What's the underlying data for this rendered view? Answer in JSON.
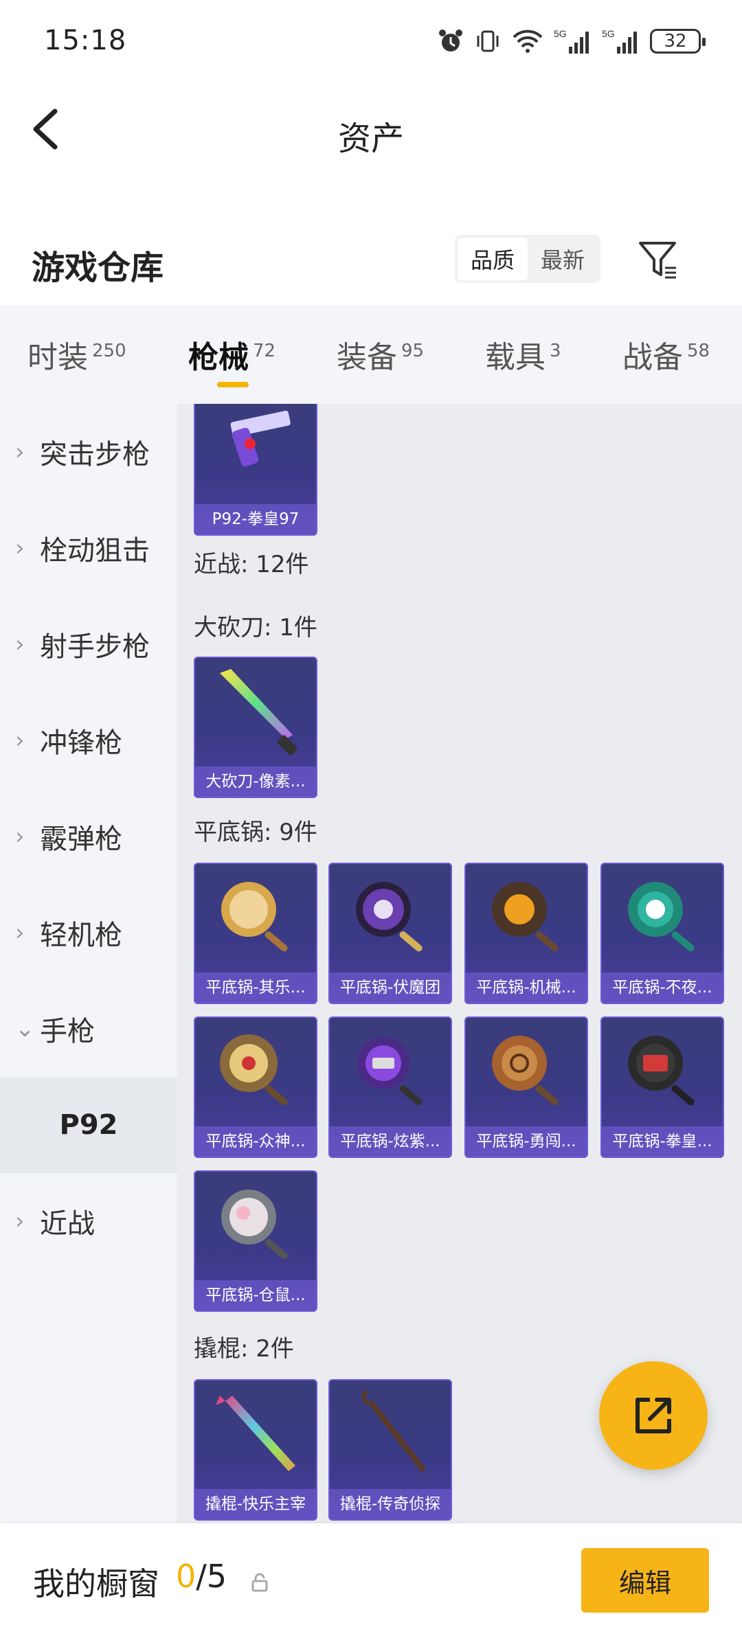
{
  "status_bar": {
    "time": "15:18",
    "battery": "32"
  },
  "header": {
    "title": "资产"
  },
  "warehouse": {
    "title": "游戏仓库",
    "sort_options": [
      {
        "label": "品质",
        "active": true
      },
      {
        "label": "最新",
        "active": false
      }
    ]
  },
  "tabs": [
    {
      "label": "时装",
      "count": "250",
      "active": false
    },
    {
      "label": "枪械",
      "count": "72",
      "active": true
    },
    {
      "label": "装备",
      "count": "95",
      "active": false
    },
    {
      "label": "载具",
      "count": "3",
      "active": false
    },
    {
      "label": "战备",
      "count": "58",
      "active": false
    }
  ],
  "sidebar": {
    "items": [
      {
        "label": "突击步枪",
        "chevron": "›"
      },
      {
        "label": "栓动狙击",
        "chevron": "›"
      },
      {
        "label": "射手步枪",
        "chevron": "›"
      },
      {
        "label": "冲锋枪",
        "chevron": "›"
      },
      {
        "label": "霰弹枪",
        "chevron": "›"
      },
      {
        "label": "轻机枪",
        "chevron": "›"
      },
      {
        "label": "手枪",
        "chevron": "⌄"
      },
      {
        "label": "P92",
        "chevron": ""
      },
      {
        "label": "近战",
        "chevron": "›"
      }
    ]
  },
  "content": {
    "top_card": {
      "label": "P92-拳皇97"
    },
    "groups": [
      {
        "label": "近战: 12件"
      },
      {
        "label": "大砍刀: 1件"
      },
      {
        "label": "平底锅: 9件"
      },
      {
        "label": "撬棍: 2件"
      }
    ],
    "machete_cards": [
      {
        "label": "大砍刀-像素..."
      }
    ],
    "pan_cards": [
      {
        "label": "平底锅-其乐..."
      },
      {
        "label": "平底锅-伏魔团"
      },
      {
        "label": "平底锅-机械..."
      },
      {
        "label": "平底锅-不夜..."
      },
      {
        "label": "平底锅-众神..."
      },
      {
        "label": "平底锅-炫紫..."
      },
      {
        "label": "平底锅-勇闯..."
      },
      {
        "label": "平底锅-拳皇..."
      },
      {
        "label": "平底锅-仓鼠..."
      }
    ],
    "crowbar_cards": [
      {
        "label": "撬棍-快乐主宰"
      },
      {
        "label": "撬棍-传奇侦探"
      }
    ]
  },
  "bottom_bar": {
    "showcase_label": "我的橱窗",
    "current": "0",
    "total": "/5",
    "edit_label": "编辑"
  },
  "colors": {
    "accent": "#f6b417",
    "card_bg": "#3b3a86",
    "card_border": "#6c5bd6"
  },
  "icons": [
    "alarm-icon",
    "vibrate-icon",
    "wifi-icon",
    "signal-icon",
    "battery-icon",
    "back-icon",
    "filter-icon",
    "share-icon",
    "lock-icon"
  ]
}
